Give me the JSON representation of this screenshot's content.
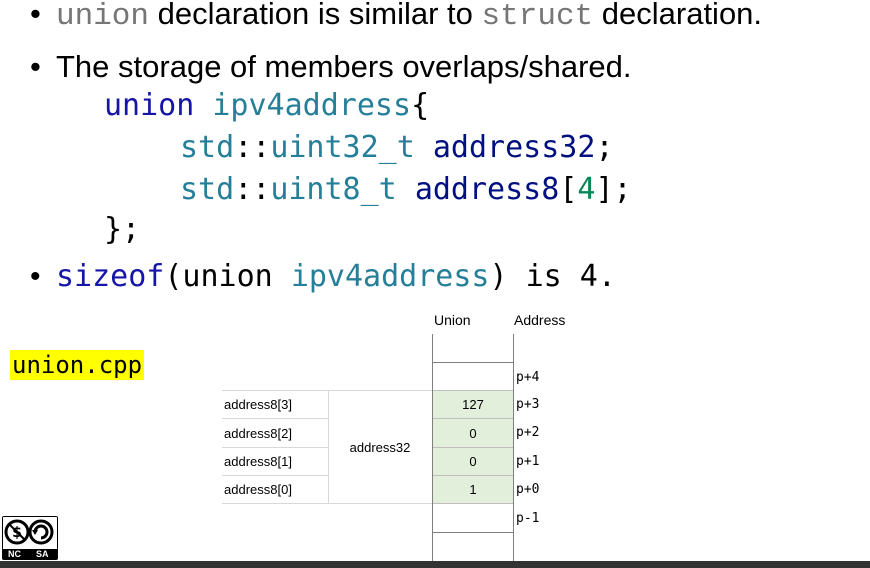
{
  "bullets": {
    "line1": {
      "kw1": "union",
      "t1": " declaration is similar to ",
      "kw2": "struct",
      "t2": " declaration."
    },
    "line2": {
      "text": "The storage of members overlaps/shared."
    },
    "line3": {
      "kw": "sizeof",
      "p1": "(union ",
      "ty": "ipv4address",
      "p2": ") is 4."
    }
  },
  "code": {
    "l1_kw": "union",
    "l1_ty": "ipv4address",
    "l1_brace": "{",
    "l2_ns": "std",
    "l2_sep": "::",
    "l2_ty": "uint32_t",
    "l2_var": "address32",
    "l2_end": ";",
    "l3_ns": "std",
    "l3_sep": "::",
    "l3_ty": "uint8_t",
    "l3_var": "address8",
    "l3_b1": "[",
    "l3_num": "4",
    "l3_b2": "];",
    "l4": "};"
  },
  "file_label": "union.cpp",
  "table": {
    "headers": {
      "union": "Union",
      "address": "Address"
    },
    "member32": "address32",
    "rows": [
      {
        "member": "address8[3]",
        "value": "127",
        "addr": "p+3"
      },
      {
        "member": "address8[2]",
        "value": "0",
        "addr": "p+2"
      },
      {
        "member": "address8[1]",
        "value": "0",
        "addr": "p+1"
      },
      {
        "member": "address8[0]",
        "value": "1",
        "addr": "p+0"
      }
    ],
    "addr_top": "p+4",
    "addr_bottom": "p-1"
  },
  "license": {
    "nc": "NC",
    "sa": "SA",
    "icon": "cc-by-nc-sa-icon"
  }
}
